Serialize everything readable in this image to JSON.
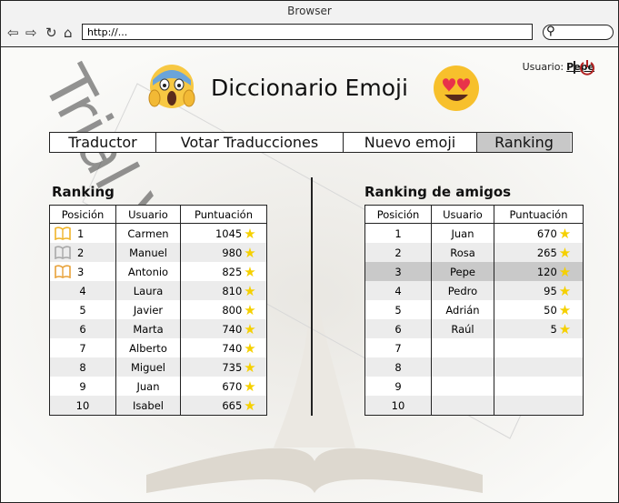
{
  "browser": {
    "title": "Browser",
    "url": "http://..."
  },
  "user": {
    "label": "Usuario:",
    "name": "Pepe"
  },
  "app": {
    "title": "Diccionario Emoji"
  },
  "tabs": [
    "Traductor",
    "Votar Traducciones",
    "Nuevo emoji",
    "Ranking"
  ],
  "active_tab": "Ranking",
  "watermark": "Trial Version",
  "ranking": {
    "title": "Ranking",
    "headers": [
      "Posición",
      "Usuario",
      "Puntuación"
    ],
    "rows": [
      {
        "pos": "1",
        "user": "Carmen",
        "score": "1045",
        "book": "gold"
      },
      {
        "pos": "2",
        "user": "Manuel",
        "score": "980",
        "book": "silver"
      },
      {
        "pos": "3",
        "user": "Antonio",
        "score": "825",
        "book": "bronze"
      },
      {
        "pos": "4",
        "user": "Laura",
        "score": "810"
      },
      {
        "pos": "5",
        "user": "Javier",
        "score": "800"
      },
      {
        "pos": "6",
        "user": "Marta",
        "score": "740"
      },
      {
        "pos": "7",
        "user": "Alberto",
        "score": "740"
      },
      {
        "pos": "8",
        "user": "Miguel",
        "score": "735"
      },
      {
        "pos": "9",
        "user": "Juan",
        "score": "670"
      },
      {
        "pos": "10",
        "user": "Isabel",
        "score": "665"
      }
    ]
  },
  "friends": {
    "title": "Ranking de amigos",
    "headers": [
      "Posición",
      "Usuario",
      "Puntuación"
    ],
    "rows": [
      {
        "pos": "1",
        "user": "Juan",
        "score": "670"
      },
      {
        "pos": "2",
        "user": "Rosa",
        "score": "265"
      },
      {
        "pos": "3",
        "user": "Pepe",
        "score": "120",
        "highlight": true
      },
      {
        "pos": "4",
        "user": "Pedro",
        "score": "95"
      },
      {
        "pos": "5",
        "user": "Adrián",
        "score": "50"
      },
      {
        "pos": "6",
        "user": "Raúl",
        "score": "5"
      },
      {
        "pos": "7",
        "user": "",
        "score": ""
      },
      {
        "pos": "8",
        "user": "",
        "score": ""
      },
      {
        "pos": "9",
        "user": "",
        "score": ""
      },
      {
        "pos": "10",
        "user": "",
        "score": ""
      }
    ]
  },
  "icons": {
    "star_color": "#f5d000",
    "gold": "#f0b429",
    "silver": "#a8a8a8",
    "bronze": "#e8a23a"
  }
}
